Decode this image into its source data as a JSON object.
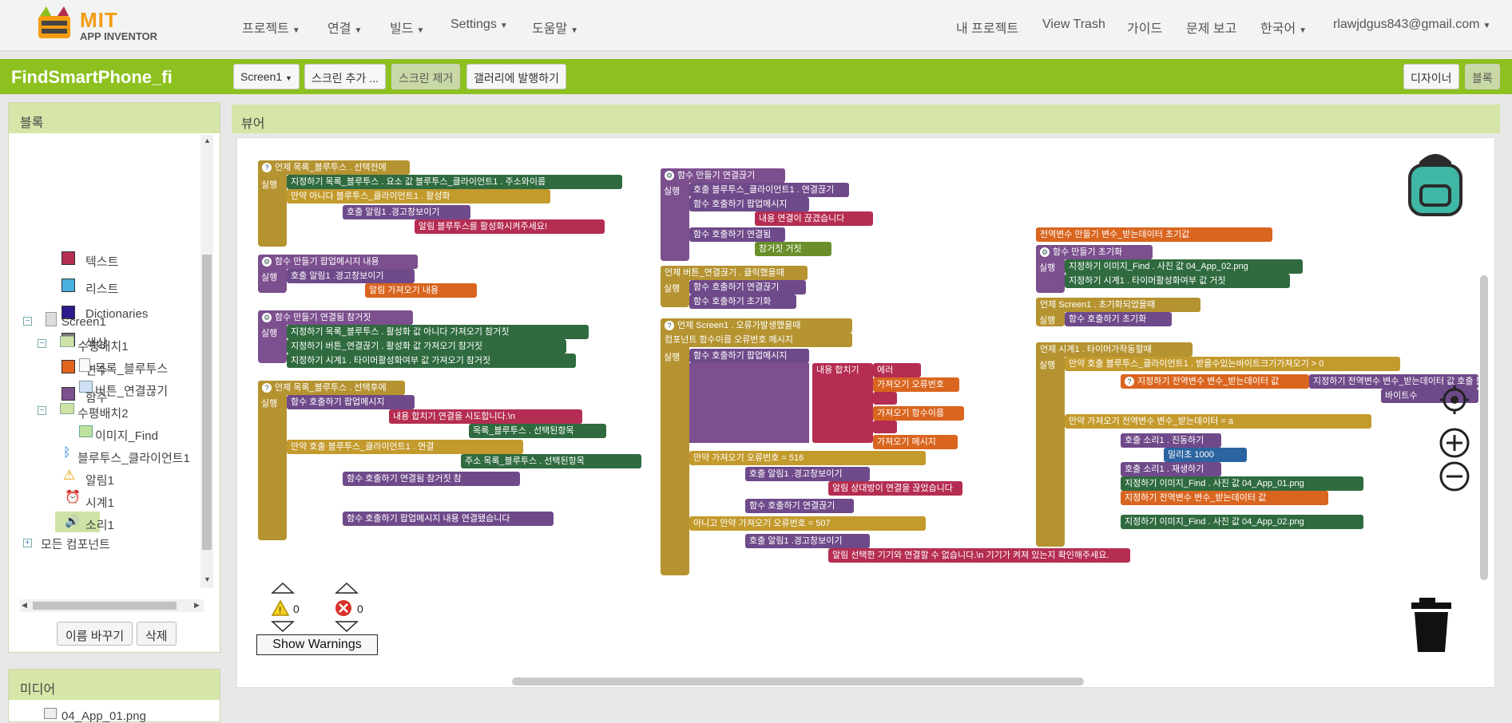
{
  "brand": {
    "mit": "MIT",
    "sub": "APP INVENTOR"
  },
  "nav": {
    "projects": "프로젝트",
    "connect": "연결",
    "build": "빌드",
    "settings": "Settings",
    "help": "도움말",
    "my_projects": "내 프로젝트",
    "view_trash": "View Trash",
    "guide": "가이드",
    "report": "문제 보고",
    "language": "한국어",
    "account": "rlawjdgus843@gmail.com"
  },
  "project": {
    "name": "FindSmartPhone_fi",
    "screen_select": "Screen1",
    "add_screen": "스크린 추가 ...",
    "remove_screen": "스크린 제거",
    "publish": "갤러리에 발행하기",
    "designer": "디자이너",
    "blocks": "블록"
  },
  "blocks_panel": {
    "title": "블록",
    "builtins": [
      {
        "label": "텍스트",
        "color": "#b52d52"
      },
      {
        "label": "리스트",
        "color": "#49b0e0"
      },
      {
        "label": "Dictionaries",
        "color": "#2a1a8c"
      },
      {
        "label": "색상",
        "color": "#7a7a7a"
      },
      {
        "label": "변수",
        "color": "#e0651f"
      },
      {
        "label": "함수",
        "color": "#7c4f8e"
      }
    ],
    "screen": "Screen1",
    "hbox1": "수평배치1",
    "listpicker": "목록_블루투스",
    "button": "버튼_연결끊기",
    "hbox2": "수평배치2",
    "image": "이미지_Find",
    "bt_client": "블루투스_클라이언트1",
    "notifier": "알림1",
    "clock": "시계1",
    "sound": "소리1",
    "all_components": "모든 컴포넌트",
    "rename": "이름 바꾸기",
    "delete": "삭제"
  },
  "media_panel": {
    "title": "미디어",
    "file1": "04_App_01.png"
  },
  "viewer": {
    "title": "뷰어",
    "warnings_count": "0",
    "errors_count": "0",
    "show_warnings": "Show Warnings"
  },
  "blocks": {
    "b1_head": "언제 목록_블루투스 . 선택전에",
    "b1_l1": "지정하기 목록_블루투스 . 요소 값 블루투스_클라이언트1 . 주소와이름",
    "b1_l2": "만약 아니다 블루투스_클라이언트1 . 활성화",
    "b1_l3": "호출 알림1 .경고창보이기",
    "b1_l4": "알림 블루투스를 활성화시켜주세요!",
    "b2_head": "함수 만들기 팝업메시지 내용",
    "b2_l1": "호출 알림1 .경고창보이기",
    "b2_l2": "알림 가져오기 내용",
    "b3_head": "함수 만들기 연결됨 참거짓",
    "b3_l1": "지정하기 목록_블루투스 . 활성화 값 아니다 가져오기 참거짓",
    "b3_l2": "지정하기 버튼_연결끊기 . 활성화 값 가져오기 참거짓",
    "b3_l3": "지정하기 시계1 . 타이머활성화여부 값 가져오기 참거짓",
    "b4_head": "언제 목록_블루투스 . 선택후에",
    "b4_l1": "함수 호출하기 팝업메시지",
    "b4_l2": "내용 합치기 연결을 시도합니다.\\n",
    "b4_l3": "목록_블루투스 . 선택된항목",
    "b4_l4": "만약 호출 블루투스_클라이언트1 . 연결",
    "b4_l5": "주소 목록_블루투스 . 선택된항목",
    "b4_l6": "함수 호출하기 연결됨 참거짓 참",
    "b4_l7": "함수 호출하기 팝업메시지 내용 연결됐습니다",
    "b5_head": "함수 만들기 연결끊기",
    "b5_l1": "호출 블루투스_클라이언트1 . 연결끊기",
    "b5_l2": "함수 호출하기 팝업메시지",
    "b5_l3": "내용 연결이 끊겼습니다",
    "b5_l4": "함수 호출하기 연결됨",
    "b5_l5": "참거짓 거짓",
    "b6_head": "언제 버튼_연결끊기 . 클릭했을때",
    "b6_l1": "함수 호출하기 연결끊기",
    "b6_l2": "함수 호출하기 초기화",
    "b7_head": "언제 Screen1 . 오류가발생했을때",
    "b7_params": "컴포넌트 함수이름 오류번호 메시지",
    "b7_l1": "함수 호출하기 팝업메시지",
    "b7_l2": "내용 합치기",
    "b7_t1": "에러",
    "b7_t2": "가져오기 오류번호",
    "b7_t3": "가져오기 함수이름",
    "b7_t4": "가져오기 메시지",
    "b7_if1": "만약 가져오기 오류번호 = 516",
    "b7_if1_do": "호출 알림1 .경고창보이기",
    "b7_if1_msg": "알림 상대방이 연결을 끊었습니다",
    "b7_if1_call": "함수 호출하기 연결끊기",
    "b7_elif": "아니고 만약 가져오기 오류번호 = 507",
    "b7_elif_do": "호출 알림1 .경고창보이기",
    "b7_elif_msg": "알림 선택한 기기와 연결할 수 없습니다.\\n 기기가 켜져 있는지 확인해주세요.",
    "b8_head": "전역변수 만들기 변수_받는데이터 초기값",
    "b9_head": "함수 만들기 초기화",
    "b9_l1": "지정하기 이미지_Find . 사진 값 04_App_02.png",
    "b9_l2": "지정하기 시계1 . 타이머활성화여부 값 거짓",
    "b10_head": "언제 Screen1 . 초기화되었을때",
    "b10_l1": "함수 호출하기 초기화",
    "b11_head": "언제 시계1 . 타이머가작동할때",
    "b11_if1": "만약 호출 블루투스_클라이언트1 . 받을수있는바이트크기가져오기 > 0",
    "b11_do1": "지정하기 전역변수 변수_받는데이터 값 호출 블루투스_클라이언트1 . 텍스트받기",
    "b11_bytes": "바이트수",
    "b11_if2": "만약 가져오기 전역변수 변수_받는데이터 = a",
    "b11_d1": "호출 소리1 . 진동하기",
    "b11_d2": "밀리초 1000",
    "b11_d3": "호출 소리1 . 재생하기",
    "b11_d4": "지정하기 이미지_Find . 사진 값 04_App_01.png",
    "b11_d5": "지정하기 전역변수 변수_받는데이터 값",
    "b11_else": "지정하기 이미지_Find . 사진 값 04_App_02.png",
    "lbl_do": "실행",
    "lbl_then": "이라면 실행",
    "lbl_elseif": "아니고 만약",
    "lbl_else": "아니라면"
  }
}
